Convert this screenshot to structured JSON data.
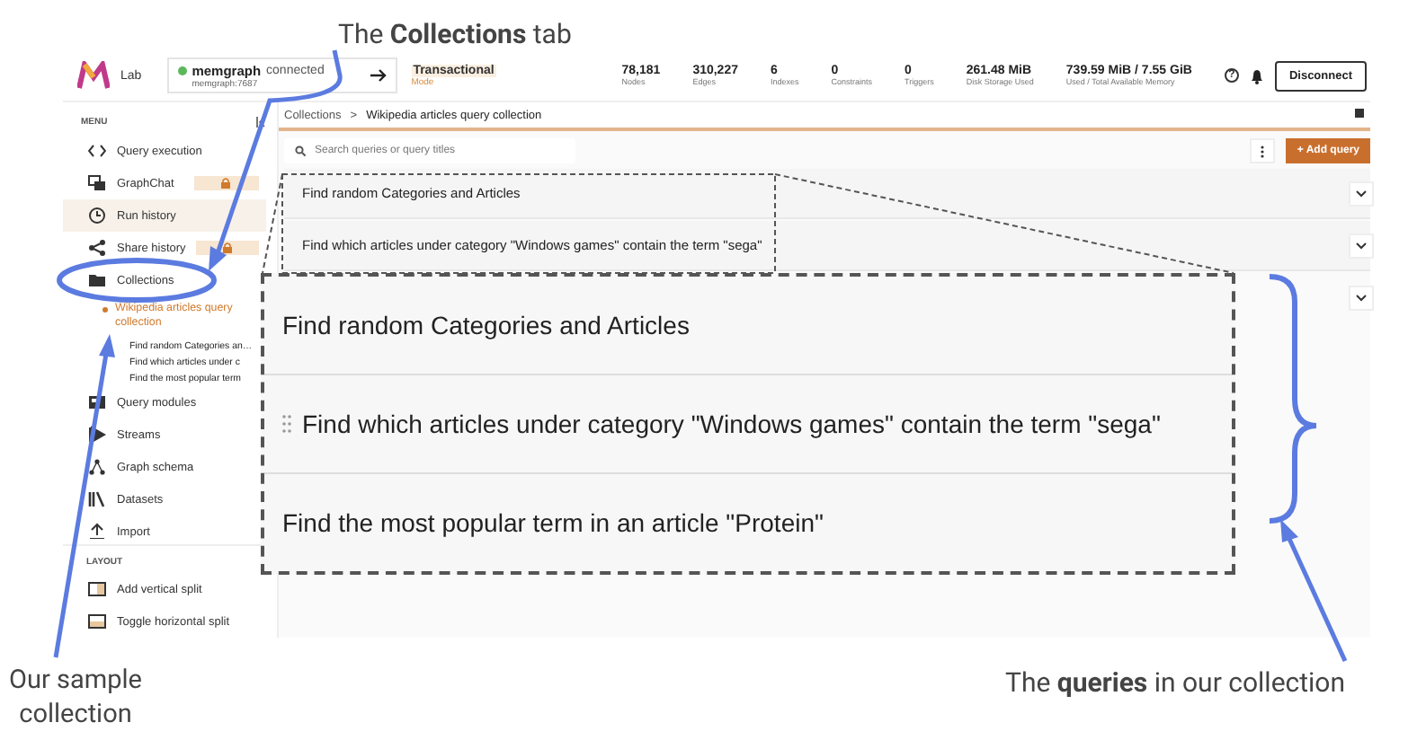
{
  "annotations": {
    "top_caption": "The **Collections** tab",
    "left_caption": "Our sample collection",
    "right_caption": "The **queries** in our collection"
  },
  "header": {
    "logo_text": "Lab",
    "connection": {
      "name": "memgraph",
      "status": "connected",
      "online": true,
      "address": "memgraph:7687"
    },
    "mode": {
      "value": "Transactional",
      "label": "Mode"
    },
    "stats": [
      {
        "value": "78,181",
        "label": "Nodes"
      },
      {
        "value": "310,227",
        "label": "Edges"
      },
      {
        "value": "6",
        "label": "Indexes"
      },
      {
        "value": "0",
        "label": "Constraints"
      },
      {
        "value": "0",
        "label": "Triggers"
      },
      {
        "value": "261.48 MiB",
        "label": "Disk Storage Used"
      },
      {
        "value": "739.59 MiB / 7.55 GiB",
        "label": "Used / Total Available Memory"
      }
    ],
    "help_label": "?",
    "disconnect_button": "Disconnect"
  },
  "sidebar": {
    "menu_label": "MENU",
    "items": [
      {
        "label": "Query execution",
        "selected": false,
        "locked": false
      },
      {
        "label": "GraphChat",
        "selected": false,
        "locked": true
      },
      {
        "label": "Run history",
        "selected": true,
        "locked": false
      },
      {
        "label": "Share history",
        "selected": false,
        "locked": true
      },
      {
        "label": "Collections",
        "selected": false,
        "locked": false,
        "expanded": true,
        "children": [
          {
            "label": "Wikipedia articles query collection",
            "selected": true,
            "children": [
              {
                "label": "Find random Categories an…"
              },
              {
                "label": "Find which articles under c"
              },
              {
                "label": "Find the most popular term"
              }
            ]
          }
        ]
      },
      {
        "label": "Query modules",
        "selected": false,
        "locked": false
      },
      {
        "label": "Streams",
        "selected": false,
        "locked": false
      },
      {
        "label": "Graph schema",
        "selected": false,
        "locked": false
      },
      {
        "label": "Datasets",
        "selected": false,
        "locked": false
      },
      {
        "label": "Import",
        "selected": false,
        "locked": false
      }
    ],
    "layout_label": "LAYOUT",
    "layout_items": [
      "Add vertical split",
      "Toggle horizontal split"
    ]
  },
  "main": {
    "breadcrumb": {
      "parent": "Collections",
      "separator": ">",
      "current": "Wikipedia articles query collection"
    },
    "search": {
      "placeholder": "Search queries or query titles"
    },
    "add_button": "+ Add query",
    "queries": [
      {
        "title": "Find random Categories and Articles",
        "expanded": false
      },
      {
        "title": "Find which articles under category \"Windows games\" contain the term \"sega\"",
        "expanded": false
      },
      {
        "expanded": false
      }
    ]
  },
  "zoom_inset": {
    "queries": [
      "Find random Categories and Articles",
      "Find which articles under category \"Windows games\" contain the term \"sega\"",
      "Find the most popular term in an article \"Protein\""
    ]
  }
}
